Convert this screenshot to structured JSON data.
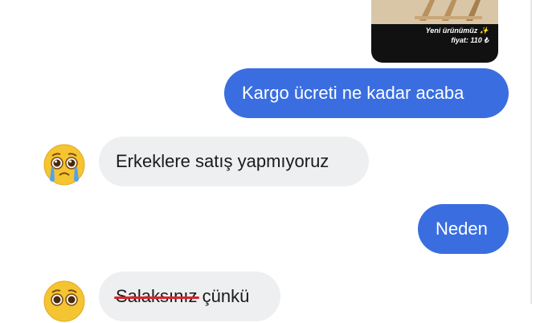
{
  "product": {
    "caption_line1": "Yeni ürünümüz",
    "caption_line2": "fiyat: 110 ₺",
    "sparkle_icon": "✨"
  },
  "messages": [
    {
      "side": "outgoing",
      "text": "Kargo ücreti ne kadar acaba"
    },
    {
      "side": "incoming",
      "text": "Erkeklere satış yapmıyoruz",
      "avatar": "crying-face-emoji"
    },
    {
      "side": "outgoing",
      "text": "Neden"
    },
    {
      "side": "incoming",
      "struck_text": "Salaksınız",
      "text": " çünkü",
      "avatar": "crying-face-emoji"
    }
  ],
  "colors": {
    "outgoing_bubble": "#3a6ee0",
    "incoming_bubble": "#eeeff1",
    "strike": "#d8262a"
  }
}
